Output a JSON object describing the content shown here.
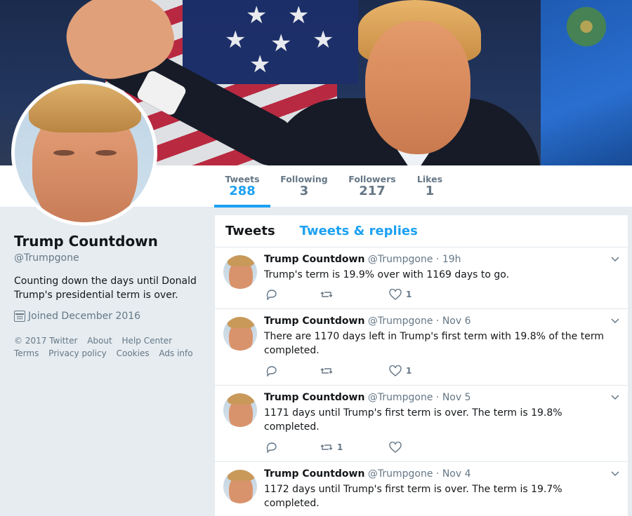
{
  "profile": {
    "name": "Trump Countdown",
    "handle": "@Trumpgone",
    "bio": "Counting down the days until Donald Trump's presidential term is over.",
    "joined": "Joined December 2016"
  },
  "stats": [
    {
      "label": "Tweets",
      "value": "288"
    },
    {
      "label": "Following",
      "value": "3"
    },
    {
      "label": "Followers",
      "value": "217"
    },
    {
      "label": "Likes",
      "value": "1"
    }
  ],
  "footer": {
    "copyright": "© 2017 Twitter",
    "about": "About",
    "help": "Help Center",
    "terms": "Terms",
    "privacy": "Privacy policy",
    "cookies": "Cookies",
    "ads": "Ads info"
  },
  "tabs": {
    "tweets": "Tweets",
    "replies": "Tweets & replies"
  },
  "tweets": [
    {
      "name": "Trump Countdown",
      "meta": "@Trumpgone · 19h",
      "text": "Trump's term is 19.9% over with 1169 days to go.",
      "retweets": "",
      "likes": "1"
    },
    {
      "name": "Trump Countdown",
      "meta": "@Trumpgone · Nov 6",
      "text": "There are 1170 days left in Trump's first term with 19.8% of the term completed.",
      "retweets": "",
      "likes": "1"
    },
    {
      "name": "Trump Countdown",
      "meta": "@Trumpgone · Nov 5",
      "text": "1171 days until Trump's first term is over. The term is 19.8% completed.",
      "retweets": "1",
      "likes": ""
    },
    {
      "name": "Trump Countdown",
      "meta": "@Trumpgone · Nov 4",
      "text": "1172 days until Trump's first term is over. The term is 19.7% completed.",
      "retweets": "",
      "likes": ""
    }
  ],
  "colors": {
    "accent": "#1da1f2",
    "muted": "#657786",
    "background": "#e6ecf0"
  }
}
